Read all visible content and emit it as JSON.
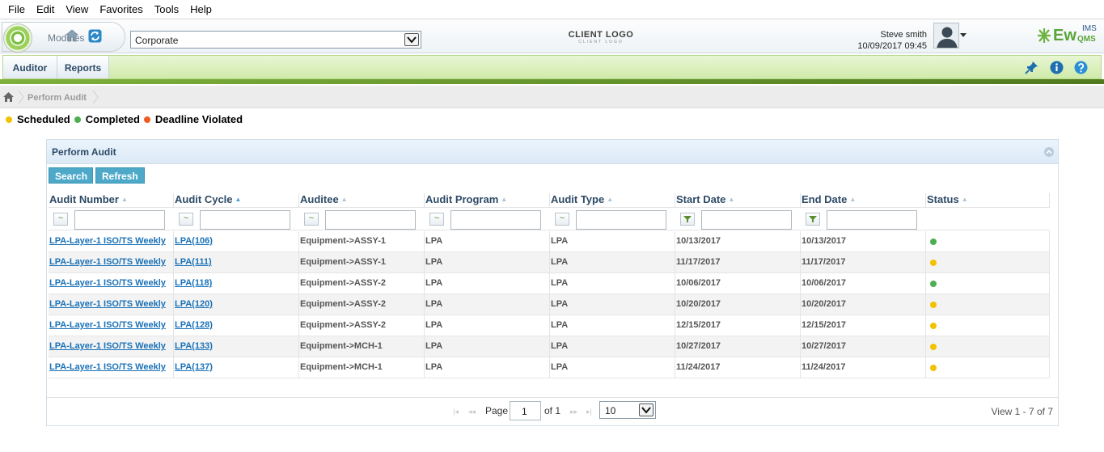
{
  "menu": [
    "File",
    "Edit",
    "View",
    "Favorites",
    "Tools",
    "Help"
  ],
  "header": {
    "modules_label": "Modules",
    "org_selected": "Corporate",
    "client_logo": "CLIENT LOGO",
    "client_logo_sub": "CLIENT LOGO",
    "user_name": "Steve smith",
    "datetime": "10/09/2017 09:45",
    "brand": "Ew",
    "brand_sup": "IMS",
    "brand_sub": "QMS"
  },
  "nav": {
    "tabs": [
      "Auditor",
      "Reports"
    ]
  },
  "breadcrumb": {
    "current": "Perform Audit"
  },
  "legend": [
    {
      "label": "Scheduled",
      "color": "#f2c200"
    },
    {
      "label": "Completed",
      "color": "#4caf50"
    },
    {
      "label": "Deadline Violated",
      "color": "#f05a23"
    }
  ],
  "panel": {
    "title": "Perform Audit",
    "search_label": "Search",
    "refresh_label": "Refresh"
  },
  "grid": {
    "columns": [
      "Audit Number",
      "Audit Cycle",
      "Auditee",
      "Audit Program",
      "Audit Type",
      "Start Date",
      "End Date",
      "Status"
    ],
    "rows": [
      {
        "number": "LPA-Layer-1 ISO/TS Weekly",
        "cycle": "LPA(106)",
        "auditee": "Equipment->ASSY-1",
        "program": "LPA",
        "type": "LPA",
        "start": "10/13/2017",
        "end": "10/13/2017",
        "status": "Completed"
      },
      {
        "number": "LPA-Layer-1 ISO/TS Weekly",
        "cycle": "LPA(111)",
        "auditee": "Equipment->ASSY-1",
        "program": "LPA",
        "type": "LPA",
        "start": "11/17/2017",
        "end": "11/17/2017",
        "status": "Scheduled"
      },
      {
        "number": "LPA-Layer-1 ISO/TS Weekly",
        "cycle": "LPA(118)",
        "auditee": "Equipment->ASSY-2",
        "program": "LPA",
        "type": "LPA",
        "start": "10/06/2017",
        "end": "10/06/2017",
        "status": "Completed"
      },
      {
        "number": "LPA-Layer-1 ISO/TS Weekly",
        "cycle": "LPA(120)",
        "auditee": "Equipment->ASSY-2",
        "program": "LPA",
        "type": "LPA",
        "start": "10/20/2017",
        "end": "10/20/2017",
        "status": "Scheduled"
      },
      {
        "number": "LPA-Layer-1 ISO/TS Weekly",
        "cycle": "LPA(128)",
        "auditee": "Equipment->ASSY-2",
        "program": "LPA",
        "type": "LPA",
        "start": "12/15/2017",
        "end": "12/15/2017",
        "status": "Scheduled"
      },
      {
        "number": "LPA-Layer-1 ISO/TS Weekly",
        "cycle": "LPA(133)",
        "auditee": "Equipment->MCH-1",
        "program": "LPA",
        "type": "LPA",
        "start": "10/27/2017",
        "end": "10/27/2017",
        "status": "Scheduled"
      },
      {
        "number": "LPA-Layer-1 ISO/TS Weekly",
        "cycle": "LPA(137)",
        "auditee": "Equipment->MCH-1",
        "program": "LPA",
        "type": "LPA",
        "start": "11/24/2017",
        "end": "11/24/2017",
        "status": "Scheduled"
      }
    ]
  },
  "pager": {
    "page_label": "Page",
    "page_value": "1",
    "of_label": "of 1",
    "page_size": "10",
    "view_info": "View 1 - 7 of 7"
  }
}
